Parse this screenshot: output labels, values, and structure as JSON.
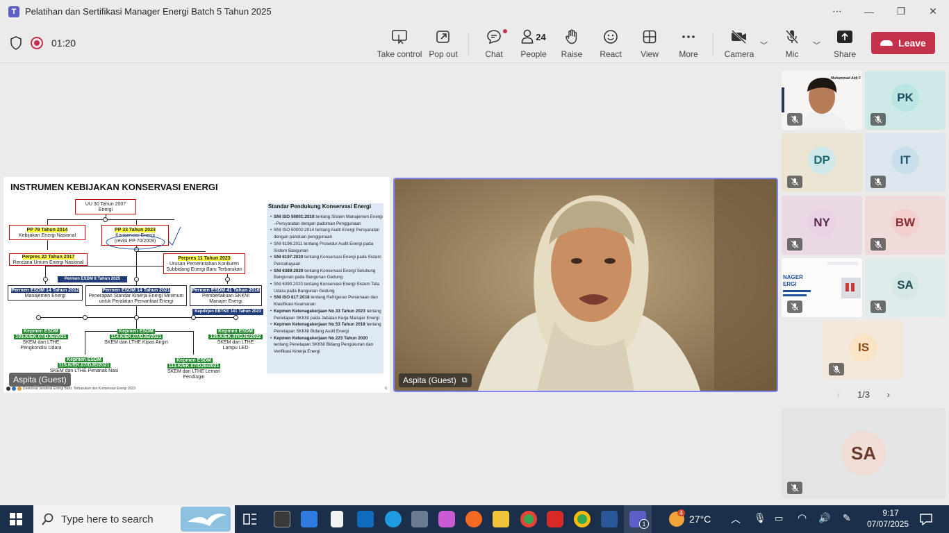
{
  "window": {
    "title": "Pelatihan dan Sertifikasi Manager Energi Batch 5 Tahun 2025",
    "logo_letter": "T"
  },
  "toolbar": {
    "timer": "01:20",
    "buttons": {
      "take_control": "Take control",
      "pop_out": "Pop out",
      "chat": "Chat",
      "people": "People",
      "people_count": "24",
      "raise": "Raise",
      "react": "React",
      "view": "View",
      "more": "More",
      "camera": "Camera",
      "mic": "Mic",
      "share": "Share",
      "leave": "Leave"
    }
  },
  "slide": {
    "title": "INSTRUMEN KEBIJAKAN KONSERVASI ENERGI",
    "uu": [
      "UU 30 Tahun 2007",
      "Energi"
    ],
    "pp79": [
      "PP 79 Tahun 2014",
      "Kebijakan Energi Nasional"
    ],
    "pp33": [
      "PP 33 Tahun 2023",
      "Konservasi Energi",
      "(revisi PP 70/2009)"
    ],
    "perpres22": [
      "Perpres 22 Tahun 2017",
      "Rencana Umum Energi Nasional"
    ],
    "perpres11": [
      "Perpres 11 Tahun 2023",
      "Urusan Pemerintahan Konkuren",
      "Subbidang Energi Baru Terbarukan"
    ],
    "permen8": "Permen ESDM 8 Tahun 2025",
    "permen14_2012": [
      "Permen ESDM 14 Tahun 2012",
      "Manajemen Energi"
    ],
    "permen14_2021": [
      "Permen ESDM 14 Tahun 2021",
      "Penerapan Standar Kinerja Energi Minimum",
      "untuk Peralatan Pemanfaat Energi"
    ],
    "permen41": [
      "Permen ESDM 41 Tahun 2016",
      "Pemberlakuan SKKNI",
      "Manajer Energi"
    ],
    "kepdirjen": "Kepdirjen EBTKE 141 Tahun 2023",
    "kep103": [
      "Kepmen ESDM",
      "103.K/EK.07/DJE/2021",
      "SKEM dan LTHE",
      "Pengkondisi Udara"
    ],
    "kep114": [
      "Kepmen ESDM",
      "114.K/EK.07/DJE/2021",
      "SKEM dan LTHE Kipas Angin"
    ],
    "kep135": [
      "Kepmen ESDM",
      "135.K/EK.07/DJE/2022",
      "SKEM dan LTHE",
      "Lampu LED"
    ],
    "kep115": [
      "Kepmen ESDM",
      "115.K/EK.07/DJE/2021",
      "SKEM dan LTHE Penanak Nasi"
    ],
    "kep113": [
      "Kepmen ESDM",
      "113.K/EK.07/DJE/2021",
      "SKEM dan LTHE Lemari Pendingin"
    ],
    "standar_head": "Standar Pendukung Konservasi Energi",
    "standar": [
      [
        "SNI ISO 50001:2018",
        " tentang Sistem Manajemen Energi –Persyaratan dengan padoman Penggunaan"
      ],
      [
        "",
        "SNI ISO 50002:2014 tentang Audit Energi Persyaratan dengan panduan penggunaan"
      ],
      [
        "",
        "SNI 6196:2011 tentang Prosedur Audit Energi pada Sistem Bangunan"
      ],
      [
        "SNI 6197:2020",
        " tentang Konservasi Energi pada Sistem Pencahayaan"
      ],
      [
        "SNI 6389:2020",
        " tentang Konservasi Energi Selubung Bangunan pada Bangunan Gedung"
      ],
      [
        "",
        "SNI 6390:2020 tentang Konservasi Energi Sistem Tata Udara pada Bangunan Gedung"
      ],
      [
        "SNI ISO 817:2018",
        " tentang Refrigeran Penamaan dan Klasifikasi Keamanan"
      ],
      [
        "Kepmen Ketenagakerjaan No.33 Tahun 2023",
        " tentang Penetapan SKKNI pada Jabatan Kerja Manajer Energi"
      ],
      [
        "Kepmen Ketenagakerjaan No.53 Tahun 2018",
        " tentang Penetapan SKKNI Bidang Audit Energi"
      ],
      [
        "Kepmen Ketenagakerjaan No.223 Tahun 2020",
        " tentang Penetapan SKKNI Bidang Pengukuran dan Verifikasi Kinerja Energi"
      ]
    ],
    "footer": "Direktorat Jenderal Energi Baru, Terbarukan dan Konservasi Energi 2023",
    "page": "6",
    "presenter_tag": "Aspita (Guest)"
  },
  "main_video": {
    "name_tag": "Aspita (Guest)"
  },
  "participants": [
    {
      "initials": "",
      "name": "Muhammad Aldi F",
      "kind": "video",
      "avatar_bg": "#e2e2e2"
    },
    {
      "initials": "PK",
      "avatar_bg": "#b9e5e3",
      "avatar_fg": "#1f4f66",
      "tile_bg": "#cde9e8"
    },
    {
      "initials": "DP",
      "avatar_bg": "#cfe9ea",
      "avatar_fg": "#1f6a73",
      "tile_bg": "#ece4d2"
    },
    {
      "initials": "IT",
      "avatar_bg": "#c9e0ec",
      "avatar_fg": "#245674",
      "tile_bg": "#dde6ee"
    },
    {
      "initials": "NY",
      "avatar_bg": "#e9d2e3",
      "avatar_fg": "#5a2a4e",
      "tile_bg": "#ead9e4"
    },
    {
      "initials": "BW",
      "avatar_bg": "#f3cfd0",
      "avatar_fg": "#8a2c33",
      "tile_bg": "#f0dbdb"
    },
    {
      "initials": "",
      "kind": "screen",
      "avatar_bg": "#fff"
    },
    {
      "initials": "SA",
      "avatar_bg": "#d6e8e6",
      "avatar_fg": "#1f4d55",
      "tile_bg": "#dfeceb"
    },
    {
      "initials": "IS",
      "avatar_bg": "#fbe3c5",
      "avatar_fg": "#8a4a10",
      "tile_bg": "#f3e8da"
    }
  ],
  "pager": {
    "label": "1/3"
  },
  "self_view": {
    "initials": "SA",
    "avatar_bg": "#efddd6",
    "avatar_fg": "#6b3a2a",
    "tile_bg": "#e4e4e4"
  },
  "taskbar": {
    "search_placeholder": "Type here to search",
    "weather_temp": "27°C",
    "weather_badge": "4",
    "time": "9:17",
    "date": "07/07/2025",
    "teams_badge": "1"
  },
  "colors": {
    "leave": "#c4314b",
    "accent": "#7f85f5",
    "taskbar": "#1c2f4a"
  }
}
